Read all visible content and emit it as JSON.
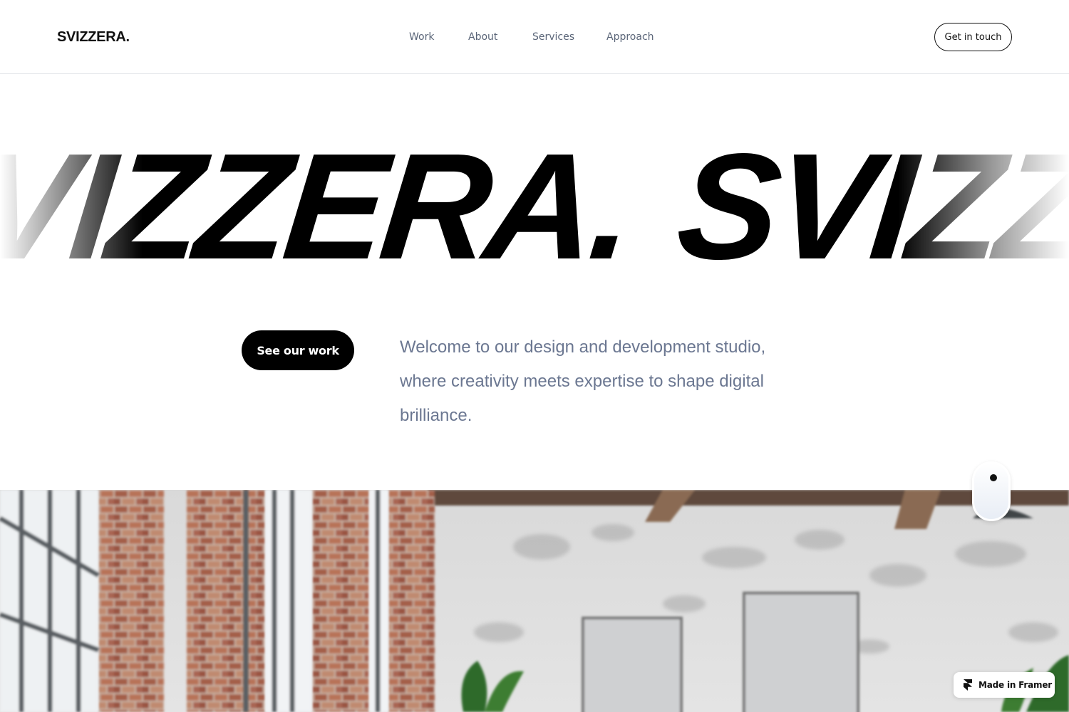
{
  "header": {
    "logo": "SVIZZERA.",
    "nav": [
      {
        "label": "Work"
      },
      {
        "label": "About"
      },
      {
        "label": "Services"
      },
      {
        "label": "Approach"
      }
    ],
    "cta_label": "Get in touch"
  },
  "hero": {
    "marquee_text": "SVIZZERA.",
    "see_work_label": "See our work",
    "intro_text": "Welcome to our design and development studio, where creativity meets expertise to shape digital brilliance."
  },
  "badge": {
    "label": "Made in Framer",
    "icon": "framer-logo-icon"
  },
  "colors": {
    "text_primary": "#111111",
    "nav_text": "#5a6578",
    "intro_text": "#6b7791",
    "button_bg": "#000000"
  }
}
